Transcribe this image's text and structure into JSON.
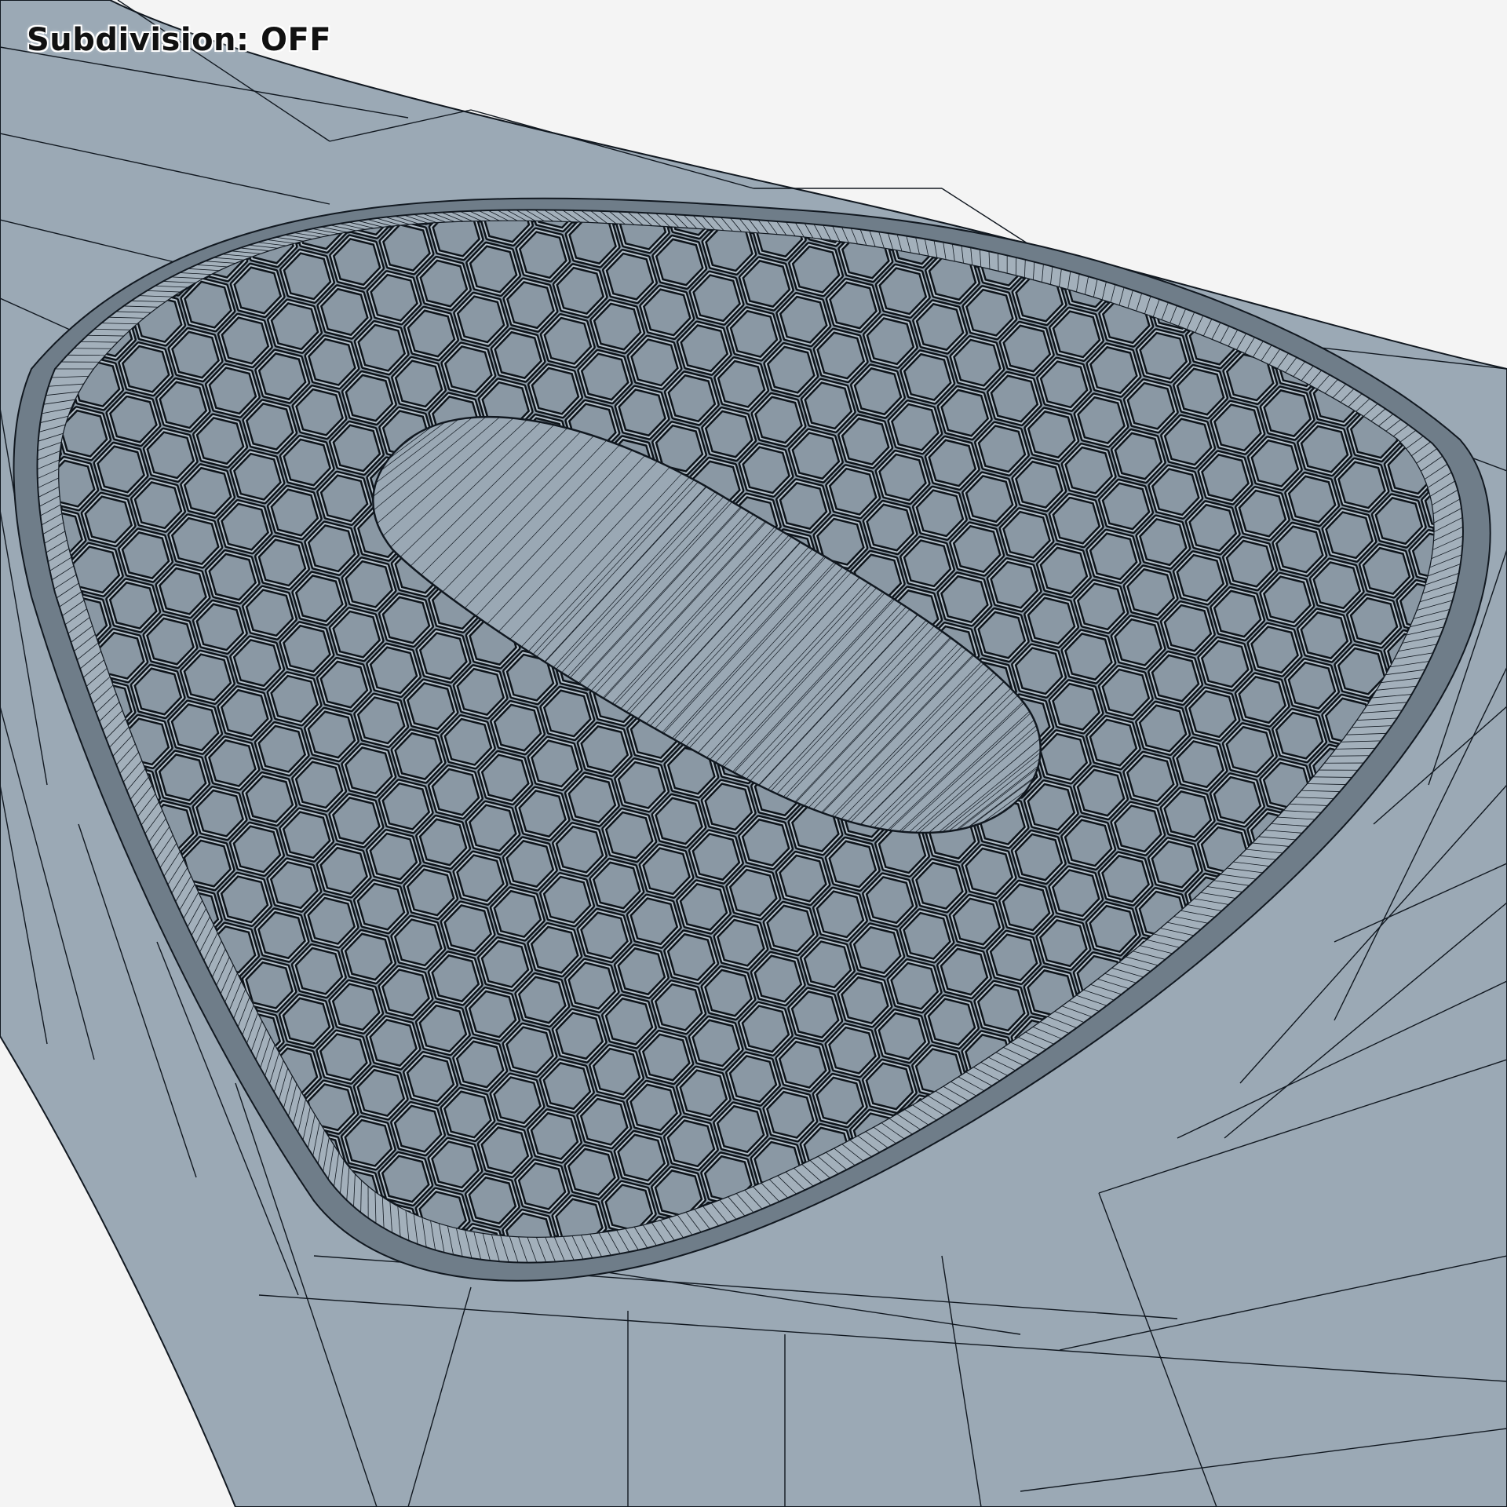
{
  "viewport": {
    "overlay_label": "Subdivision: OFF"
  },
  "colors": {
    "background": "#f4f4f4",
    "surface": "#9aa8b4",
    "surface_light": "#a9b6c1",
    "surface_dark": "#7f8e9a",
    "wire": "#111820",
    "hex_fill": "#8c9aa6"
  },
  "icons": []
}
